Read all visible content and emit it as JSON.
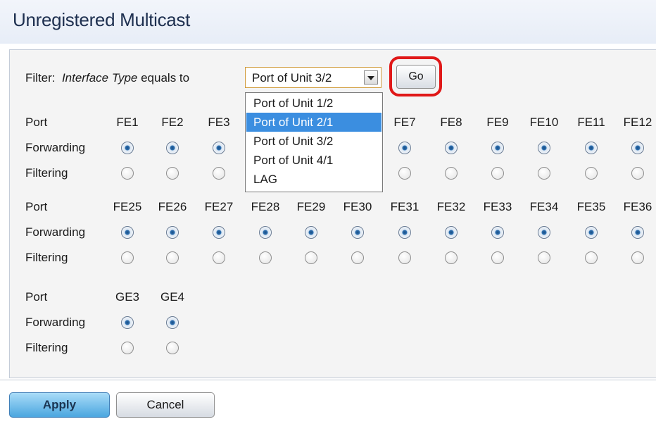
{
  "page": {
    "title": "Unregistered Multicast"
  },
  "filter": {
    "label_prefix": "Filter:",
    "label_field": "Interface Type",
    "label_suffix": "equals to",
    "selected_value": "Port of Unit 3/2",
    "go_label": "Go",
    "options": [
      "Port of Unit 1/2",
      "Port of Unit 2/1",
      "Port of Unit 3/2",
      "Port of Unit 4/1",
      "LAG"
    ],
    "highlighted_option": "Port of Unit 2/1"
  },
  "row_labels": {
    "port": "Port",
    "forwarding": "Forwarding",
    "filtering": "Filtering"
  },
  "port_groups": [
    {
      "ports": [
        "FE1",
        "FE2",
        "FE3",
        "",
        "",
        "",
        "FE7",
        "FE8",
        "FE9",
        "FE10",
        "FE11",
        "FE12"
      ],
      "forwarding": [
        true,
        true,
        true,
        false,
        false,
        false,
        true,
        true,
        true,
        true,
        true,
        true
      ],
      "filtering": [
        false,
        false,
        false,
        false,
        false,
        false,
        false,
        false,
        false,
        false,
        false,
        false
      ]
    },
    {
      "ports": [
        "FE25",
        "FE26",
        "FE27",
        "FE28",
        "FE29",
        "FE30",
        "FE31",
        "FE32",
        "FE33",
        "FE34",
        "FE35",
        "FE36"
      ],
      "forwarding": [
        true,
        true,
        true,
        true,
        true,
        true,
        true,
        true,
        true,
        true,
        true,
        true
      ],
      "filtering": [
        false,
        false,
        false,
        false,
        false,
        false,
        false,
        false,
        false,
        false,
        false,
        false
      ]
    },
    {
      "ports": [
        "GE3",
        "GE4"
      ],
      "forwarding": [
        true,
        true
      ],
      "filtering": [
        false,
        false
      ]
    }
  ],
  "actions": {
    "apply_label": "Apply",
    "cancel_label": "Cancel"
  }
}
